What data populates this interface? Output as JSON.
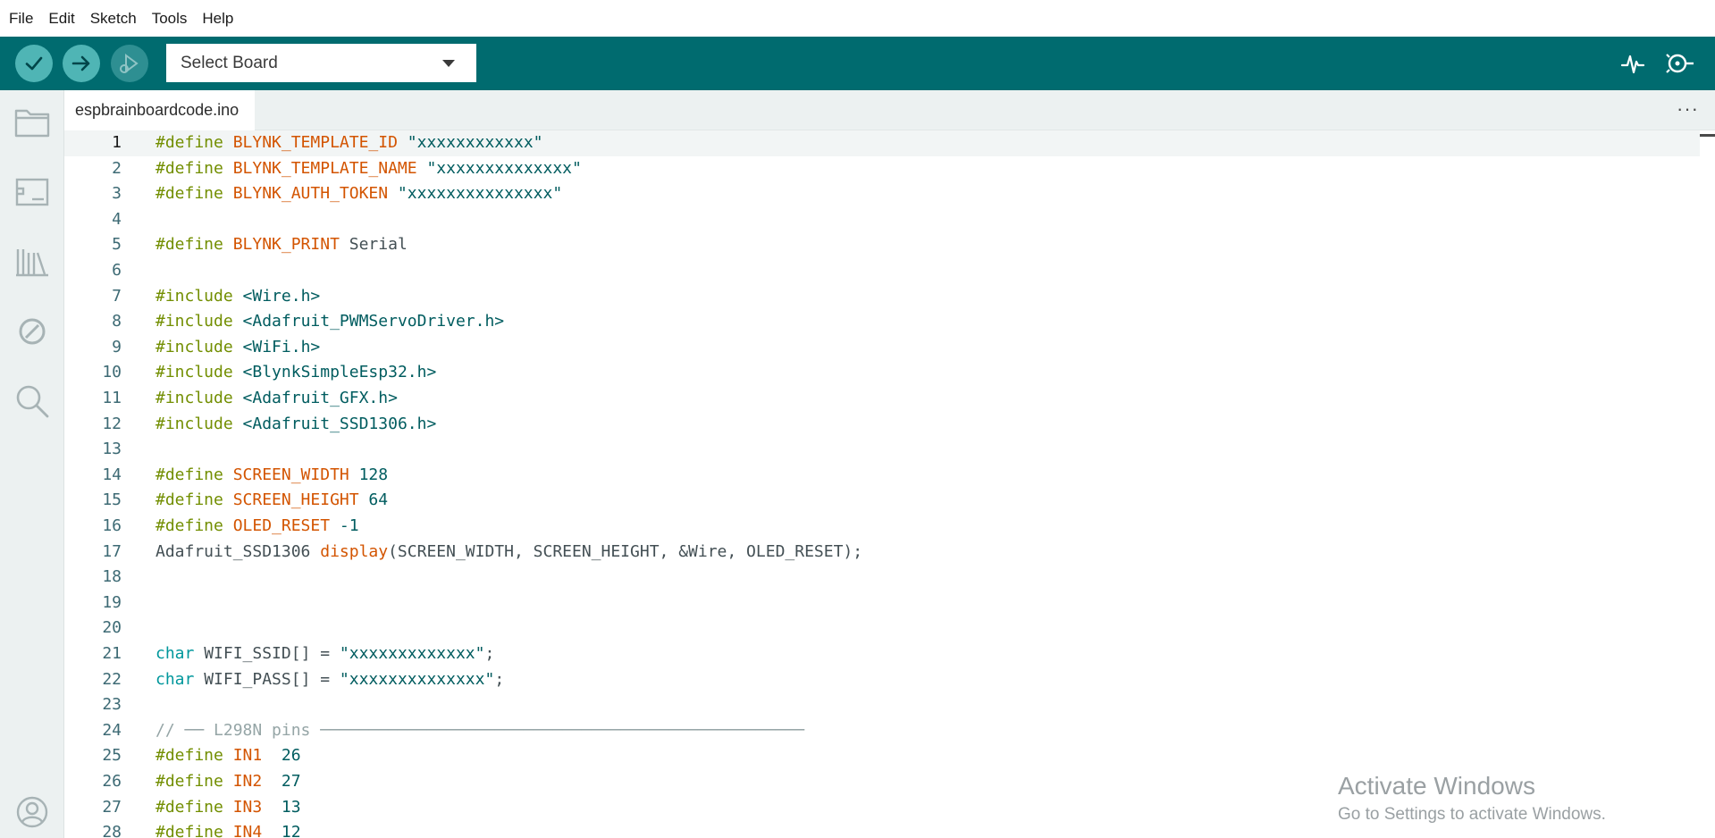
{
  "menubar": {
    "items": [
      "File",
      "Edit",
      "Sketch",
      "Tools",
      "Help"
    ]
  },
  "toolbar": {
    "verify_icon": "check-icon",
    "upload_icon": "arrow-right-icon",
    "debug_icon": "debug-icon",
    "board_select": {
      "label": "Select Board",
      "icon": "chevron-down-icon"
    },
    "right_icons": [
      "serial-plotter-icon",
      "serial-monitor-icon"
    ],
    "accent_color": "#006b6f"
  },
  "sidebar": {
    "icons": [
      "folder-icon",
      "board-manager-icon",
      "library-icon",
      "debug-disabled-icon",
      "search-icon",
      "account-icon"
    ]
  },
  "tabs": {
    "active_file": "espbrainboardcode.ino",
    "more_label": "···"
  },
  "editor": {
    "current_line": 1,
    "lines": [
      {
        "n": "1",
        "tokens": [
          {
            "t": "kw",
            "v": "#define "
          },
          {
            "t": "id",
            "v": "BLYNK_TEMPLATE_ID"
          },
          {
            "t": "str",
            "v": " \"xxxxxxxxxxxx\""
          }
        ]
      },
      {
        "n": "2",
        "tokens": [
          {
            "t": "kw",
            "v": "#define "
          },
          {
            "t": "id",
            "v": "BLYNK_TEMPLATE_NAME"
          },
          {
            "t": "str",
            "v": " \"xxxxxxxxxxxxxx\""
          }
        ]
      },
      {
        "n": "3",
        "tokens": [
          {
            "t": "kw",
            "v": "#define "
          },
          {
            "t": "id",
            "v": "BLYNK_AUTH_TOKEN"
          },
          {
            "t": "str",
            "v": " \"xxxxxxxxxxxxxxx\""
          }
        ]
      },
      {
        "n": "4",
        "tokens": []
      },
      {
        "n": "5",
        "tokens": [
          {
            "t": "kw",
            "v": "#define "
          },
          {
            "t": "id",
            "v": "BLYNK_PRINT"
          },
          {
            "t": "plain",
            "v": " Serial"
          }
        ]
      },
      {
        "n": "6",
        "tokens": []
      },
      {
        "n": "7",
        "tokens": [
          {
            "t": "kw",
            "v": "#include "
          },
          {
            "t": "str",
            "v": "<Wire.h>"
          }
        ]
      },
      {
        "n": "8",
        "tokens": [
          {
            "t": "kw",
            "v": "#include "
          },
          {
            "t": "str",
            "v": "<Adafruit_PWMServoDriver.h>"
          }
        ]
      },
      {
        "n": "9",
        "tokens": [
          {
            "t": "kw",
            "v": "#include "
          },
          {
            "t": "str",
            "v": "<WiFi.h>"
          }
        ]
      },
      {
        "n": "10",
        "tokens": [
          {
            "t": "kw",
            "v": "#include "
          },
          {
            "t": "str",
            "v": "<BlynkSimpleEsp32.h>"
          }
        ]
      },
      {
        "n": "11",
        "tokens": [
          {
            "t": "kw",
            "v": "#include "
          },
          {
            "t": "str",
            "v": "<Adafruit_GFX.h>"
          }
        ]
      },
      {
        "n": "12",
        "tokens": [
          {
            "t": "kw",
            "v": "#include "
          },
          {
            "t": "str",
            "v": "<Adafruit_SSD1306.h>"
          }
        ]
      },
      {
        "n": "13",
        "tokens": []
      },
      {
        "n": "14",
        "tokens": [
          {
            "t": "kw",
            "v": "#define "
          },
          {
            "t": "id",
            "v": "SCREEN_WIDTH"
          },
          {
            "t": "num",
            "v": " 128"
          }
        ]
      },
      {
        "n": "15",
        "tokens": [
          {
            "t": "kw",
            "v": "#define "
          },
          {
            "t": "id",
            "v": "SCREEN_HEIGHT"
          },
          {
            "t": "num",
            "v": " 64"
          }
        ]
      },
      {
        "n": "16",
        "tokens": [
          {
            "t": "kw",
            "v": "#define "
          },
          {
            "t": "id",
            "v": "OLED_RESET"
          },
          {
            "t": "num",
            "v": " -1"
          }
        ]
      },
      {
        "n": "17",
        "tokens": [
          {
            "t": "plain",
            "v": "Adafruit_SSD1306 "
          },
          {
            "t": "fn",
            "v": "display"
          },
          {
            "t": "plain",
            "v": "(SCREEN_WIDTH, SCREEN_HEIGHT, &Wire, OLED_RESET);"
          }
        ]
      },
      {
        "n": "18",
        "tokens": []
      },
      {
        "n": "19",
        "tokens": []
      },
      {
        "n": "20",
        "tokens": []
      },
      {
        "n": "21",
        "tokens": [
          {
            "t": "type",
            "v": "char"
          },
          {
            "t": "plain",
            "v": " WIFI_SSID[] = "
          },
          {
            "t": "str",
            "v": "\"xxxxxxxxxxxxx\""
          },
          {
            "t": "plain",
            "v": ";"
          }
        ]
      },
      {
        "n": "22",
        "tokens": [
          {
            "t": "type",
            "v": "char"
          },
          {
            "t": "plain",
            "v": " WIFI_PASS[] = "
          },
          {
            "t": "str",
            "v": "\"xxxxxxxxxxxxxx\""
          },
          {
            "t": "plain",
            "v": ";"
          }
        ]
      },
      {
        "n": "23",
        "tokens": []
      },
      {
        "n": "24",
        "tokens": [
          {
            "t": "cm",
            "v": "// ── L298N pins ──────────────────────────────────────────────────"
          }
        ]
      },
      {
        "n": "25",
        "tokens": [
          {
            "t": "kw",
            "v": "#define "
          },
          {
            "t": "id",
            "v": "IN1"
          },
          {
            "t": "num",
            "v": "  26"
          }
        ]
      },
      {
        "n": "26",
        "tokens": [
          {
            "t": "kw",
            "v": "#define "
          },
          {
            "t": "id",
            "v": "IN2"
          },
          {
            "t": "num",
            "v": "  27"
          }
        ]
      },
      {
        "n": "27",
        "tokens": [
          {
            "t": "kw",
            "v": "#define "
          },
          {
            "t": "id",
            "v": "IN3"
          },
          {
            "t": "num",
            "v": "  13"
          }
        ]
      },
      {
        "n": "28",
        "tokens": [
          {
            "t": "kw",
            "v": "#define "
          },
          {
            "t": "id",
            "v": "IN4"
          },
          {
            "t": "num",
            "v": "  12"
          }
        ]
      }
    ]
  },
  "watermark": {
    "title": "Activate Windows",
    "subtitle": "Go to Settings to activate Windows."
  }
}
